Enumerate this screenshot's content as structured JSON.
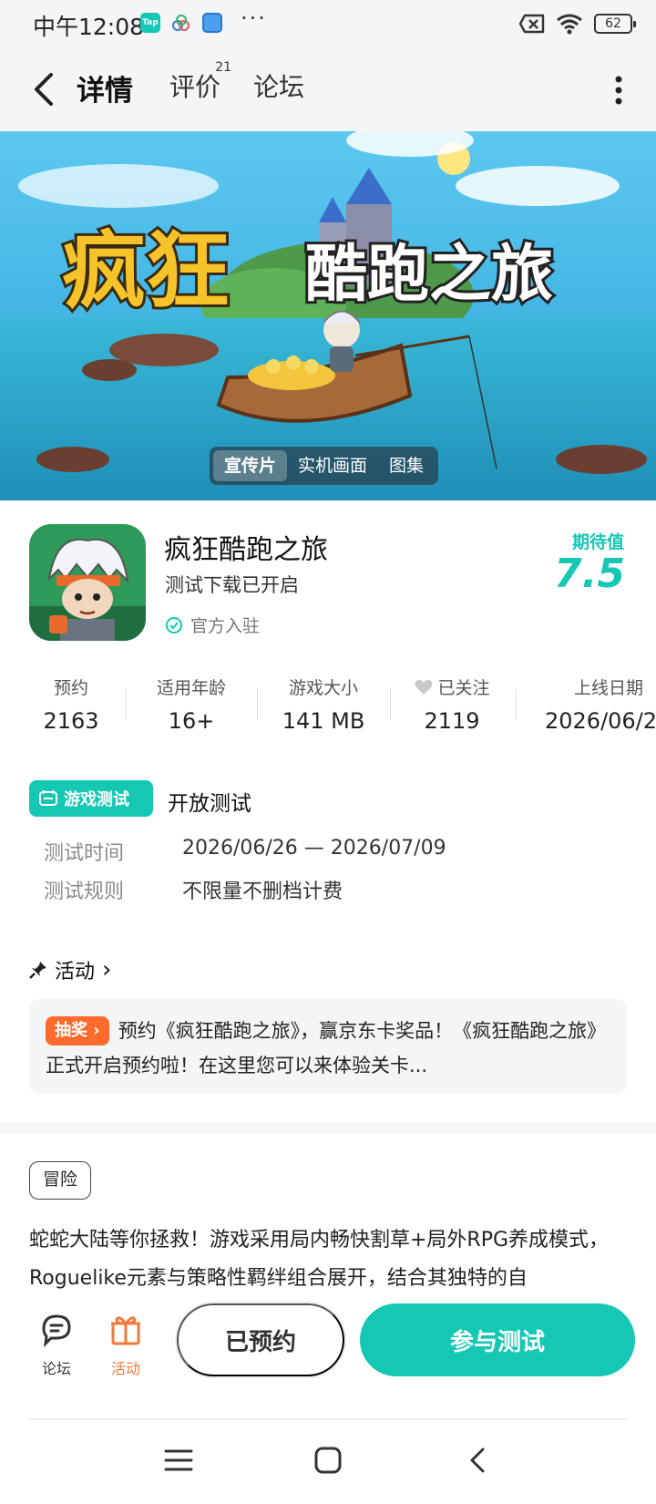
{
  "status_bar": {
    "time": "中午12:08",
    "app_icons": [
      "tap-icon",
      "cloud-icon",
      "wallet-icon"
    ],
    "tap_label": "Tap",
    "more": "···",
    "battery": "62"
  },
  "nav": {
    "tabs": [
      {
        "label": "详情",
        "active": true
      },
      {
        "label": "评价",
        "badge": "21"
      },
      {
        "label": "论坛"
      }
    ]
  },
  "hero": {
    "media_tabs": [
      {
        "label": "宣传片",
        "active": true
      },
      {
        "label": "实机画面"
      },
      {
        "label": "图集"
      }
    ],
    "banner_title_left": "疯狂",
    "banner_title_right": "酷跑之旅"
  },
  "game": {
    "title": "疯狂酷跑之旅",
    "status": "测试下载已开启",
    "official": "官方入驻",
    "expect_label": "期待值",
    "expect_value": "7.5"
  },
  "stats": [
    {
      "label": "预约",
      "value": "2163"
    },
    {
      "label": "适用年龄",
      "value": "16+"
    },
    {
      "label": "游戏大小",
      "value": "141 MB"
    },
    {
      "label": "已关注",
      "value": "2119"
    },
    {
      "label": "上线日期",
      "value": "2026/06/2"
    }
  ],
  "test": {
    "badge": "游戏测试",
    "type": "开放测试",
    "rows": [
      {
        "key": "测试时间",
        "value": "2026/06/26 — 2026/07/09"
      },
      {
        "key": "测试规则",
        "value": "不限量不删档计费"
      }
    ]
  },
  "activity": {
    "heading": "活动",
    "chevron": "›",
    "tag": "抽奖",
    "text": "预约《疯狂酷跑之旅》，赢京东卡奖品！《疯狂酷跑之旅》正式开启预约啦！在这里您可以来体验关卡..."
  },
  "genre_tag": "冒险",
  "description": "蛇蛇大陆等你拯救！游戏采用局内畅快割草+局外RPG养成模式，Roguelike元素与策略性羁绊组合展开，结合其独特的自",
  "action_bar": {
    "forum_label": "论坛",
    "activity_label": "活动",
    "reserved_label": "已预约",
    "join_label": "参与测试"
  },
  "colors": {
    "accent": "#14c8b4",
    "orange": "#ff6b2c",
    "activity_icon": "#f07a3a"
  }
}
